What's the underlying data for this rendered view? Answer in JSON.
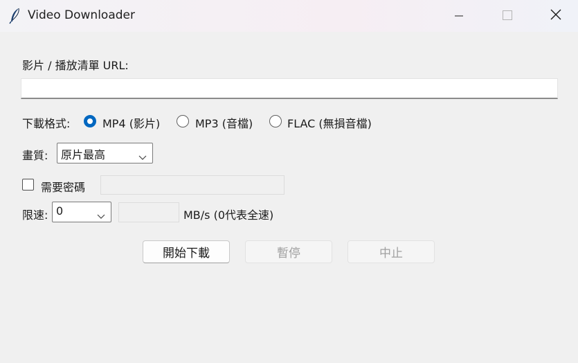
{
  "window": {
    "title": "Video Downloader",
    "icon": "feather-icon",
    "controls": [
      "minimize-icon",
      "maximize-icon",
      "close-icon"
    ]
  },
  "url": {
    "label": "影片 / 播放清單 URL:",
    "value": ""
  },
  "format": {
    "label": "下載格式:",
    "options": [
      {
        "label": "MP4 (影片)",
        "selected": true
      },
      {
        "label": "MP3 (音檔)",
        "selected": false
      },
      {
        "label": "FLAC (無損音檔)",
        "selected": false
      }
    ]
  },
  "quality": {
    "label": "畫質:",
    "selected": "原片最高"
  },
  "password": {
    "label": "需要密碼",
    "checked": false,
    "value": ""
  },
  "speed": {
    "label": "限速:",
    "selected": "0",
    "custom_value": "",
    "unit_label": "MB/s (0代表全速)"
  },
  "buttons": {
    "start": "開始下載",
    "pause": "暫停",
    "stop": "中止"
  },
  "colors": {
    "accent": "#0067c0",
    "window_bg": "#f0f0f0"
  }
}
